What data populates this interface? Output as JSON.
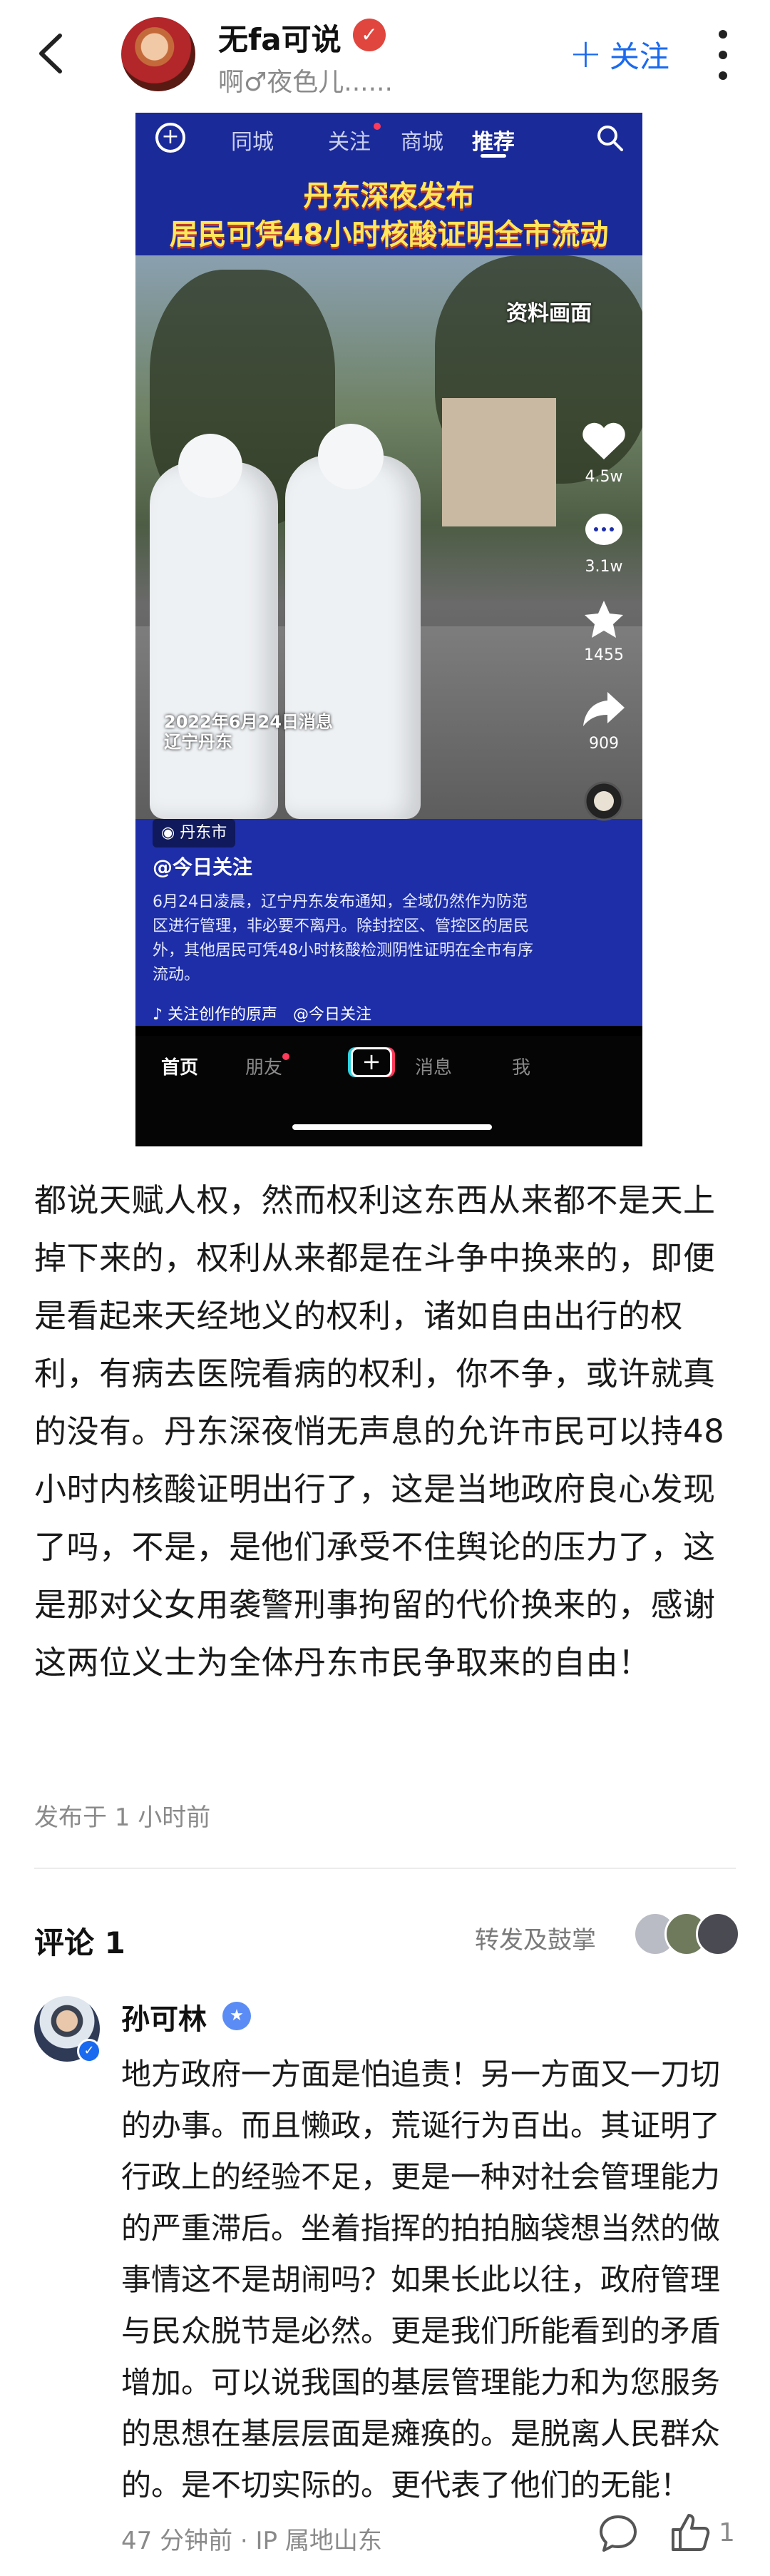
{
  "header": {
    "user_name": "无fa可说",
    "user_subtitle": "啊♂夜色儿......",
    "follow_label": "关注",
    "follow_plus": "+"
  },
  "video": {
    "top_tabs": [
      "同城",
      "关注",
      "商城",
      "推荐"
    ],
    "headline": [
      "丹东深夜发布",
      "居民可凭48小时核酸证明全市流动"
    ],
    "photo_tag": "资料画面",
    "photo_date": [
      "2022年6月24日消息",
      "辽宁丹东"
    ],
    "location": "丹东市",
    "account": "@今日关注",
    "description": "6月24日凌晨，辽宁丹东发布通知，全域仍然作为防范区进行管理，非必要不离丹。除封控区、管控区的居民外，其他居民可凭48小时核酸检测阴性证明在全市有序流动。",
    "music": "♪ 关注创作的原声　@今日关注",
    "likes": "4.5w",
    "comments": "3.1w",
    "favorites": "1455",
    "shares": "909",
    "bottom_nav": [
      "首页",
      "朋友",
      "消息",
      "我"
    ],
    "create_label": "+"
  },
  "post": {
    "text": "都说天赋人权，然而权利这东西从来都不是天上掉下来的，权利从来都是在斗争中换来的，即便是看起来天经地义的权利，诸如自由出行的权利，有病去医院看病的权利，你不争，或许就真的没有。丹东深夜悄无声息的允许市民可以持48小时内核酸证明出行了，这是当地政府良心发现了吗，不是，是他们承受不住舆论的压力了，这是那对父女用袭警刑事拘留的代价换来的，感谢这两位义士为全体丹东市民争取来的自由！",
    "time": "发布于 1 小时前"
  },
  "comments": {
    "title": "评论 1",
    "repost_label": "转发及鼓掌",
    "items": [
      {
        "name": "孙可林",
        "text": "地方政府一方面是怕追责！另一方面又一刀切的办事。而且懒政，荒诞行为百出。其证明了行政上的经验不足，更是一种对社会管理能力的严重滞后。坐着指挥的拍拍脑袋想当然的做事情这不是胡闹吗？如果长此以往，政府管理与民众脱节是必然。更是我们所能看到的矛盾增加。可以说我国的基层管理能力和为您服务的思想在基层层面是瘫痪的。是脱离人民群众的。是不切实际的。更代表了他们的无能！",
        "meta": "47 分钟前 · IP 属地山东",
        "likes": "1"
      }
    ]
  },
  "colors": {
    "accent": "#1a6af0",
    "video_blue": "#1d2ea8",
    "headline_yellow": "#ffe65a"
  }
}
